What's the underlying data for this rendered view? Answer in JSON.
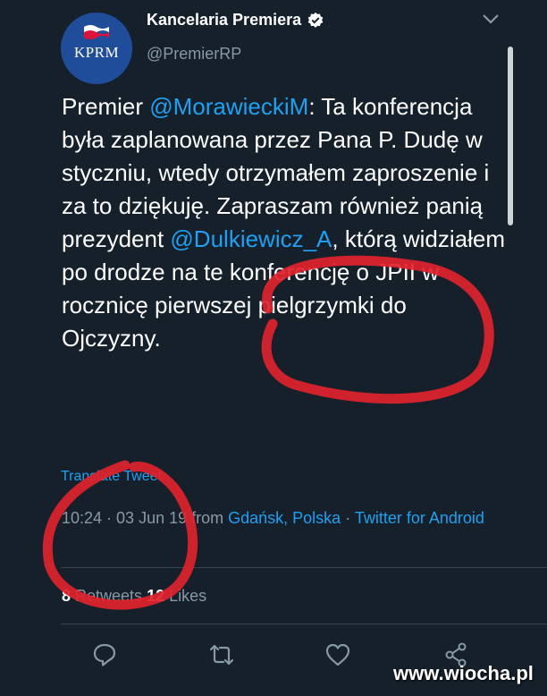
{
  "account": {
    "display_name": "Kancelaria Premiera",
    "handle": "@PremierRP",
    "avatar_text": "KPRM"
  },
  "tweet": {
    "pre": "Premier ",
    "mention1": "@MorawieckiM",
    "text1": ": Ta konferencja była zaplanowana przez Pana P. Dudę w styczniu, wtedy otrzymałem zaproszenie i za to dziękuję. Zapraszam również panią prezydent ",
    "mention2": "@Dulkiewicz_A",
    "text2": ", którą widziałem po drodze na te konferencję o JPII w rocznicę pierwszej pielgrzymki do Ojczyzny."
  },
  "translate_label": "Translate Tweet",
  "meta": {
    "time": "10:24 · 03 Jun 19",
    "from": " from ",
    "location": "Gdańsk, Polska",
    "separator": " · ",
    "source": "Twitter for Android"
  },
  "stats": {
    "retweets_count": "8",
    "retweets_label": " Retweets ",
    "likes_count": "12",
    "likes_label": " Likes"
  },
  "icons": [
    "verified-icon",
    "chevron-down-icon",
    "reply-icon",
    "retweet-icon",
    "like-icon",
    "share-icon"
  ],
  "colors": {
    "background": "#15202b",
    "link": "#1da1f2",
    "muted": "#8899a6",
    "annotation": "#e0232d"
  },
  "watermark": "www.wiocha.pl"
}
